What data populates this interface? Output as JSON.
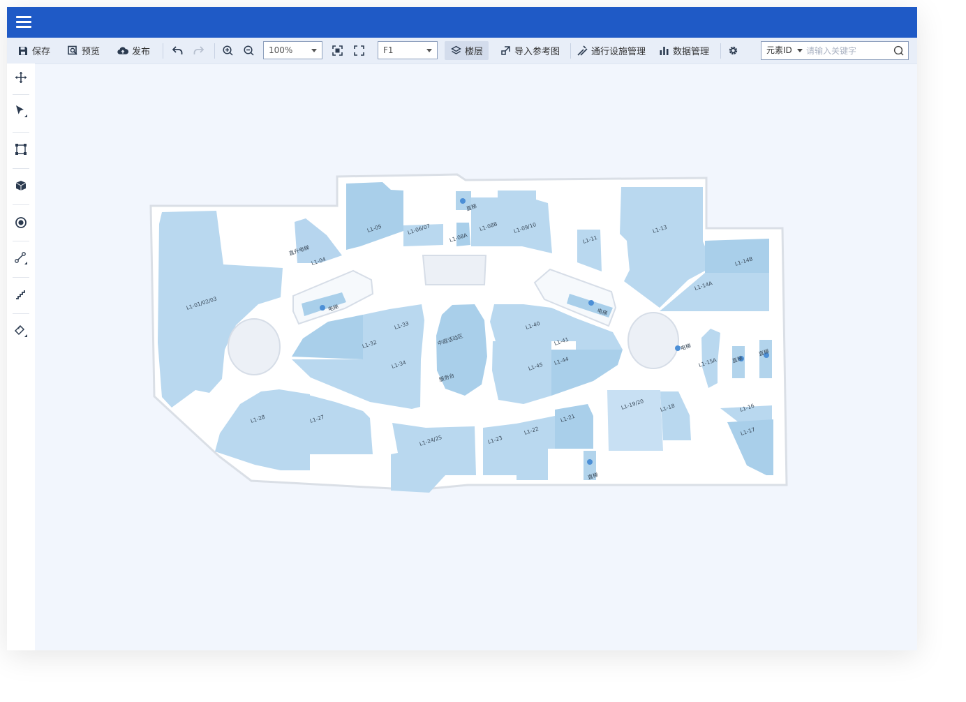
{
  "menu": {
    "icon": "menu-icon"
  },
  "toolbar": {
    "save": "保存",
    "preview": "预览",
    "publish": "发布",
    "zoom_value": "100%",
    "floor_value": "F1",
    "layers": "楼层",
    "import_ref": "导入参考图",
    "passage_mgmt": "通行设施管理",
    "data_mgmt": "数据管理"
  },
  "search": {
    "type": "元素ID",
    "placeholder": "请输入关键字"
  },
  "side_tools": [
    "move-icon",
    "select-arrow-icon",
    "transform-icon",
    "cube-icon",
    "point-icon",
    "line-icon",
    "stairs-icon",
    "measure-icon"
  ],
  "map": {
    "shops": [
      "L1-01/02/03",
      "L1-04",
      "L1-05",
      "L1-06/07",
      "L1-08A",
      "L1-08B",
      "L1-09/10",
      "L1-11",
      "L1-13",
      "L1-14A",
      "L1-14B",
      "L1-15A",
      "L1-16",
      "L1-17",
      "L1-18",
      "L1-19/20",
      "L1-21",
      "L1-22",
      "L1-23",
      "L1-24/25",
      "L1-27",
      "L1-28",
      "L1-32",
      "L1-33",
      "L1-34",
      "L1-40",
      "L1-41",
      "L1-44",
      "L1-45"
    ],
    "facilities": {
      "escalator": "直升电梯",
      "elevator": "电梯",
      "straight_elevator": "直梯",
      "center_area": "中庭活动区",
      "service_desk": "服务台"
    }
  }
}
